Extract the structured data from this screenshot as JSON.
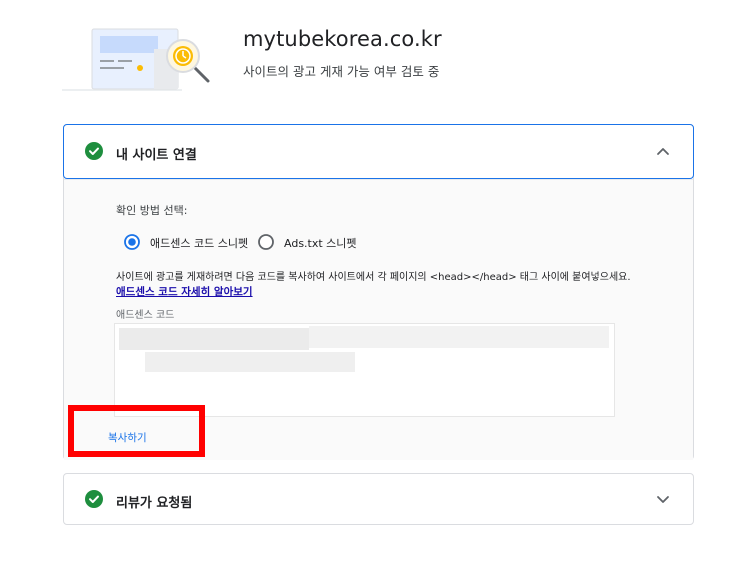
{
  "header": {
    "site_name": "mytubekorea.co.kr",
    "status_text": "사이트의 광고 게재 가능 여부 검토 중"
  },
  "sections": {
    "connect": {
      "title": "내 사이트 연결",
      "method_label": "확인 방법 선택:",
      "options": [
        {
          "label": "애드센스 코드 스니펫",
          "selected": true
        },
        {
          "label": "Ads.txt 스니펫",
          "selected": false
        }
      ],
      "instruction": "사이트에 광고를 게재하려면 다음 코드를 복사하여 사이트에서 각 페이지의 <head></head> 태그 사이에 붙여넣으세요.",
      "learn_more": "애드센스 코드 자세히 알아보기",
      "code_label": "애드센스 코드",
      "copy_label": "복사하기"
    },
    "review": {
      "title": "리뷰가 요청됨"
    }
  },
  "colors": {
    "accent": "#1a73e8",
    "success": "#1e8e3e",
    "highlight": "#ff0000"
  },
  "icons": [
    "verified-check-icon",
    "chevron-up-icon",
    "chevron-down-icon",
    "radio-selected-icon",
    "radio-unselected-icon",
    "clock-magnifier-icon"
  ]
}
